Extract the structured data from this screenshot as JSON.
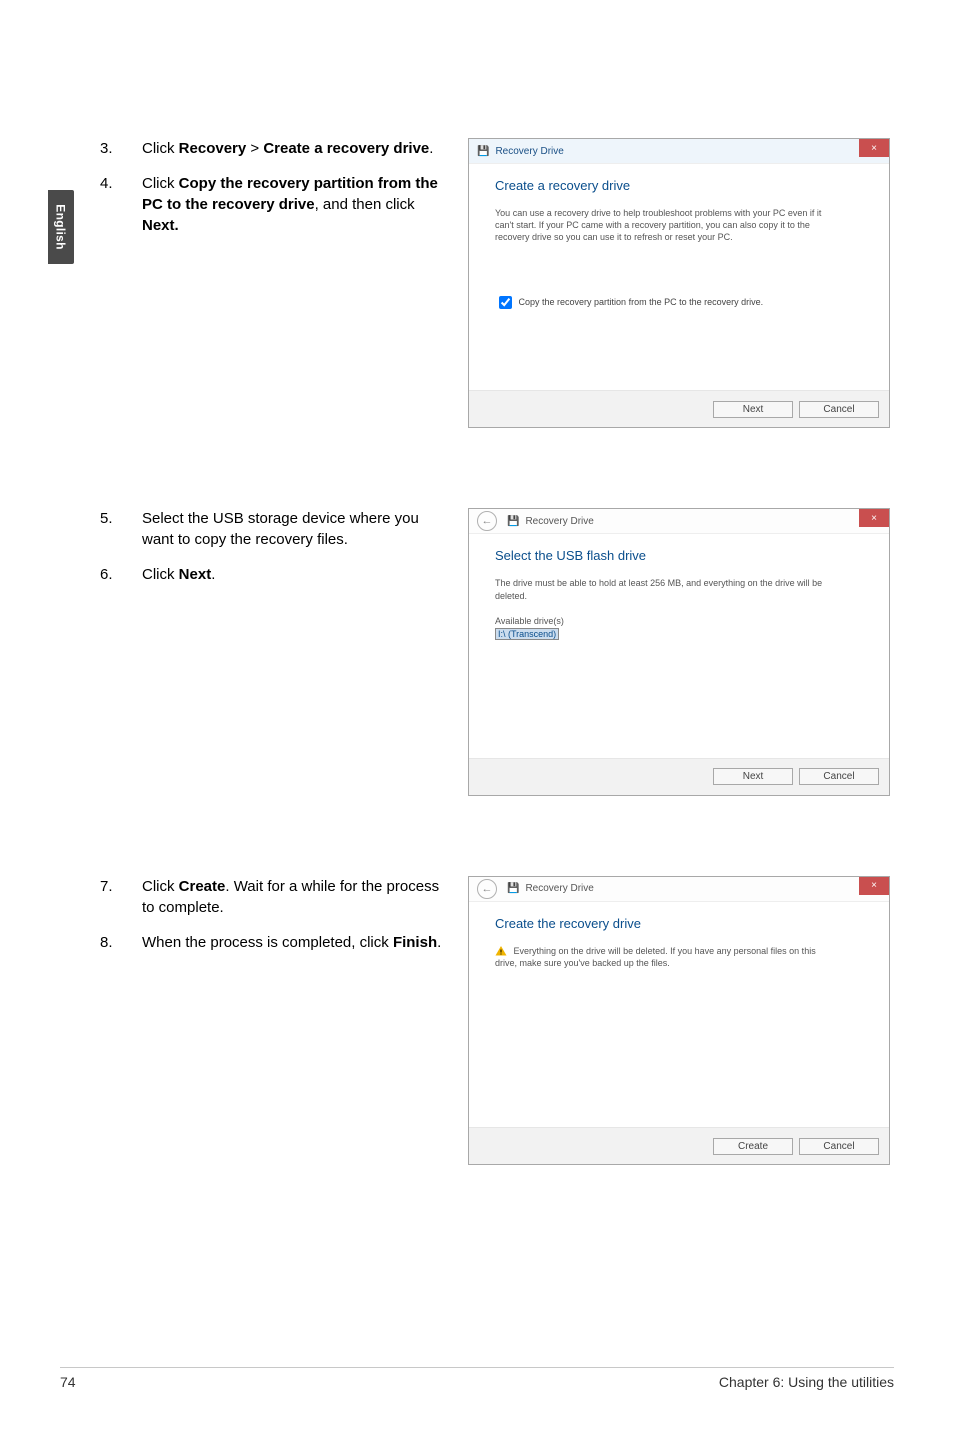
{
  "side_tab": "English",
  "blocks": {
    "b1": {
      "steps": [
        {
          "n": "3.",
          "html": "Click <b>Recovery</b> > <b>Create a recovery drive</b>."
        },
        {
          "n": "4.",
          "html": "Click <b>Copy the recovery partition from the PC to the recovery drive</b>, and then click <b>Next.</b>"
        }
      ],
      "dlg": {
        "title": "Recovery Drive",
        "heading": "Create a recovery drive",
        "para": "You can use a recovery drive to help troubleshoot problems with your PC even if it can't start. If your PC came with a recovery partition, you can also copy it to the recovery drive so you can use it to refresh or reset your PC.",
        "checkbox": "Copy the recovery partition from the PC to the recovery drive.",
        "primary": "Next",
        "secondary": "Cancel",
        "close": "×"
      }
    },
    "b2": {
      "steps": [
        {
          "n": "5.",
          "html": "Select the USB storage device where you want to copy the recovery files."
        },
        {
          "n": "6.",
          "html": "Click <b>Next</b>."
        }
      ],
      "dlg": {
        "title": "Recovery Drive",
        "heading": "Select the USB flash drive",
        "para": "The drive must be able to hold at least 256 MB, and everything on the drive will be deleted.",
        "list_label": "Available drive(s)",
        "list_item": "I:\\ (Transcend)",
        "primary": "Next",
        "secondary": "Cancel",
        "close": "×",
        "back": "←"
      }
    },
    "b3": {
      "steps": [
        {
          "n": "7.",
          "html": "Click <b>Create</b>. Wait for a while for the process to complete."
        },
        {
          "n": "8.",
          "html": "When the process is completed, click <b>Finish</b>."
        }
      ],
      "dlg": {
        "title": "Recovery Drive",
        "heading": "Create the recovery drive",
        "warning": "Everything on the drive will be deleted. If you have any personal files on this drive, make sure you've backed up the files.",
        "primary": "Create",
        "secondary": "Cancel",
        "close": "×",
        "back": "←"
      }
    }
  },
  "footer": {
    "page": "74",
    "chapter": "Chapter 6: Using the utilities"
  }
}
